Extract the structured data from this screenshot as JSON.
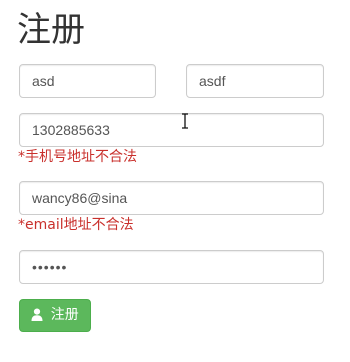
{
  "page": {
    "title": "注册"
  },
  "form": {
    "first_name": {
      "value": "asd"
    },
    "last_name": {
      "value": "asdf"
    },
    "phone": {
      "value": "1302885633",
      "error": "*手机号地址不合法"
    },
    "email": {
      "value": "wancy86@sina",
      "error": "*email地址不合法"
    },
    "password": {
      "value": "••••••"
    },
    "submit": {
      "label": "注册",
      "icon": "user-icon"
    }
  },
  "colors": {
    "error": "#c9302c",
    "button_bg": "#5cb85c",
    "input_border": "#cccccc"
  }
}
